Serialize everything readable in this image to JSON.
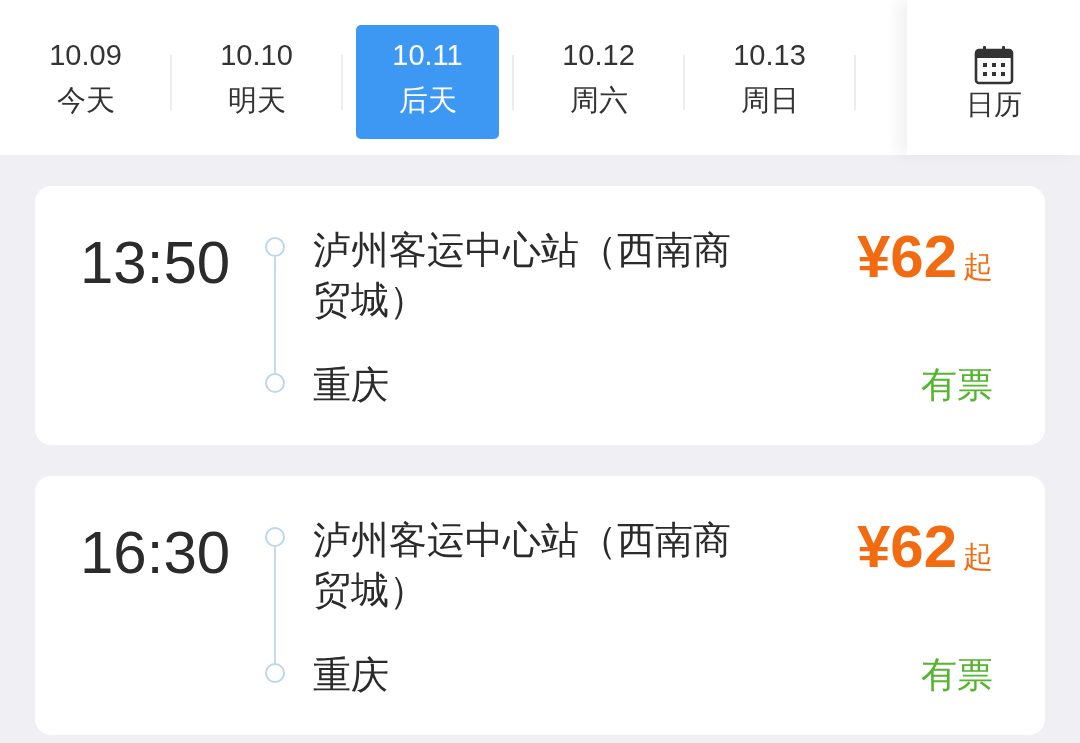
{
  "date_tabs": [
    {
      "date": "10.09",
      "day": "今天",
      "selected": false
    },
    {
      "date": "10.10",
      "day": "明天",
      "selected": false
    },
    {
      "date": "10.11",
      "day": "后天",
      "selected": true
    },
    {
      "date": "10.12",
      "day": "周六",
      "selected": false
    },
    {
      "date": "10.13",
      "day": "周日",
      "selected": false
    }
  ],
  "calendar_button": {
    "label": "日历"
  },
  "trips": [
    {
      "departure_time": "13:50",
      "from_station": "泸州客运中心站（西南商贸城）",
      "to_station": "重庆",
      "price": "¥62",
      "price_suffix": "起",
      "availability": "有票"
    },
    {
      "departure_time": "16:30",
      "from_station": "泸州客运中心站（西南商贸城）",
      "to_station": "重庆",
      "price": "¥62",
      "price_suffix": "起",
      "availability": "有票"
    }
  ]
}
